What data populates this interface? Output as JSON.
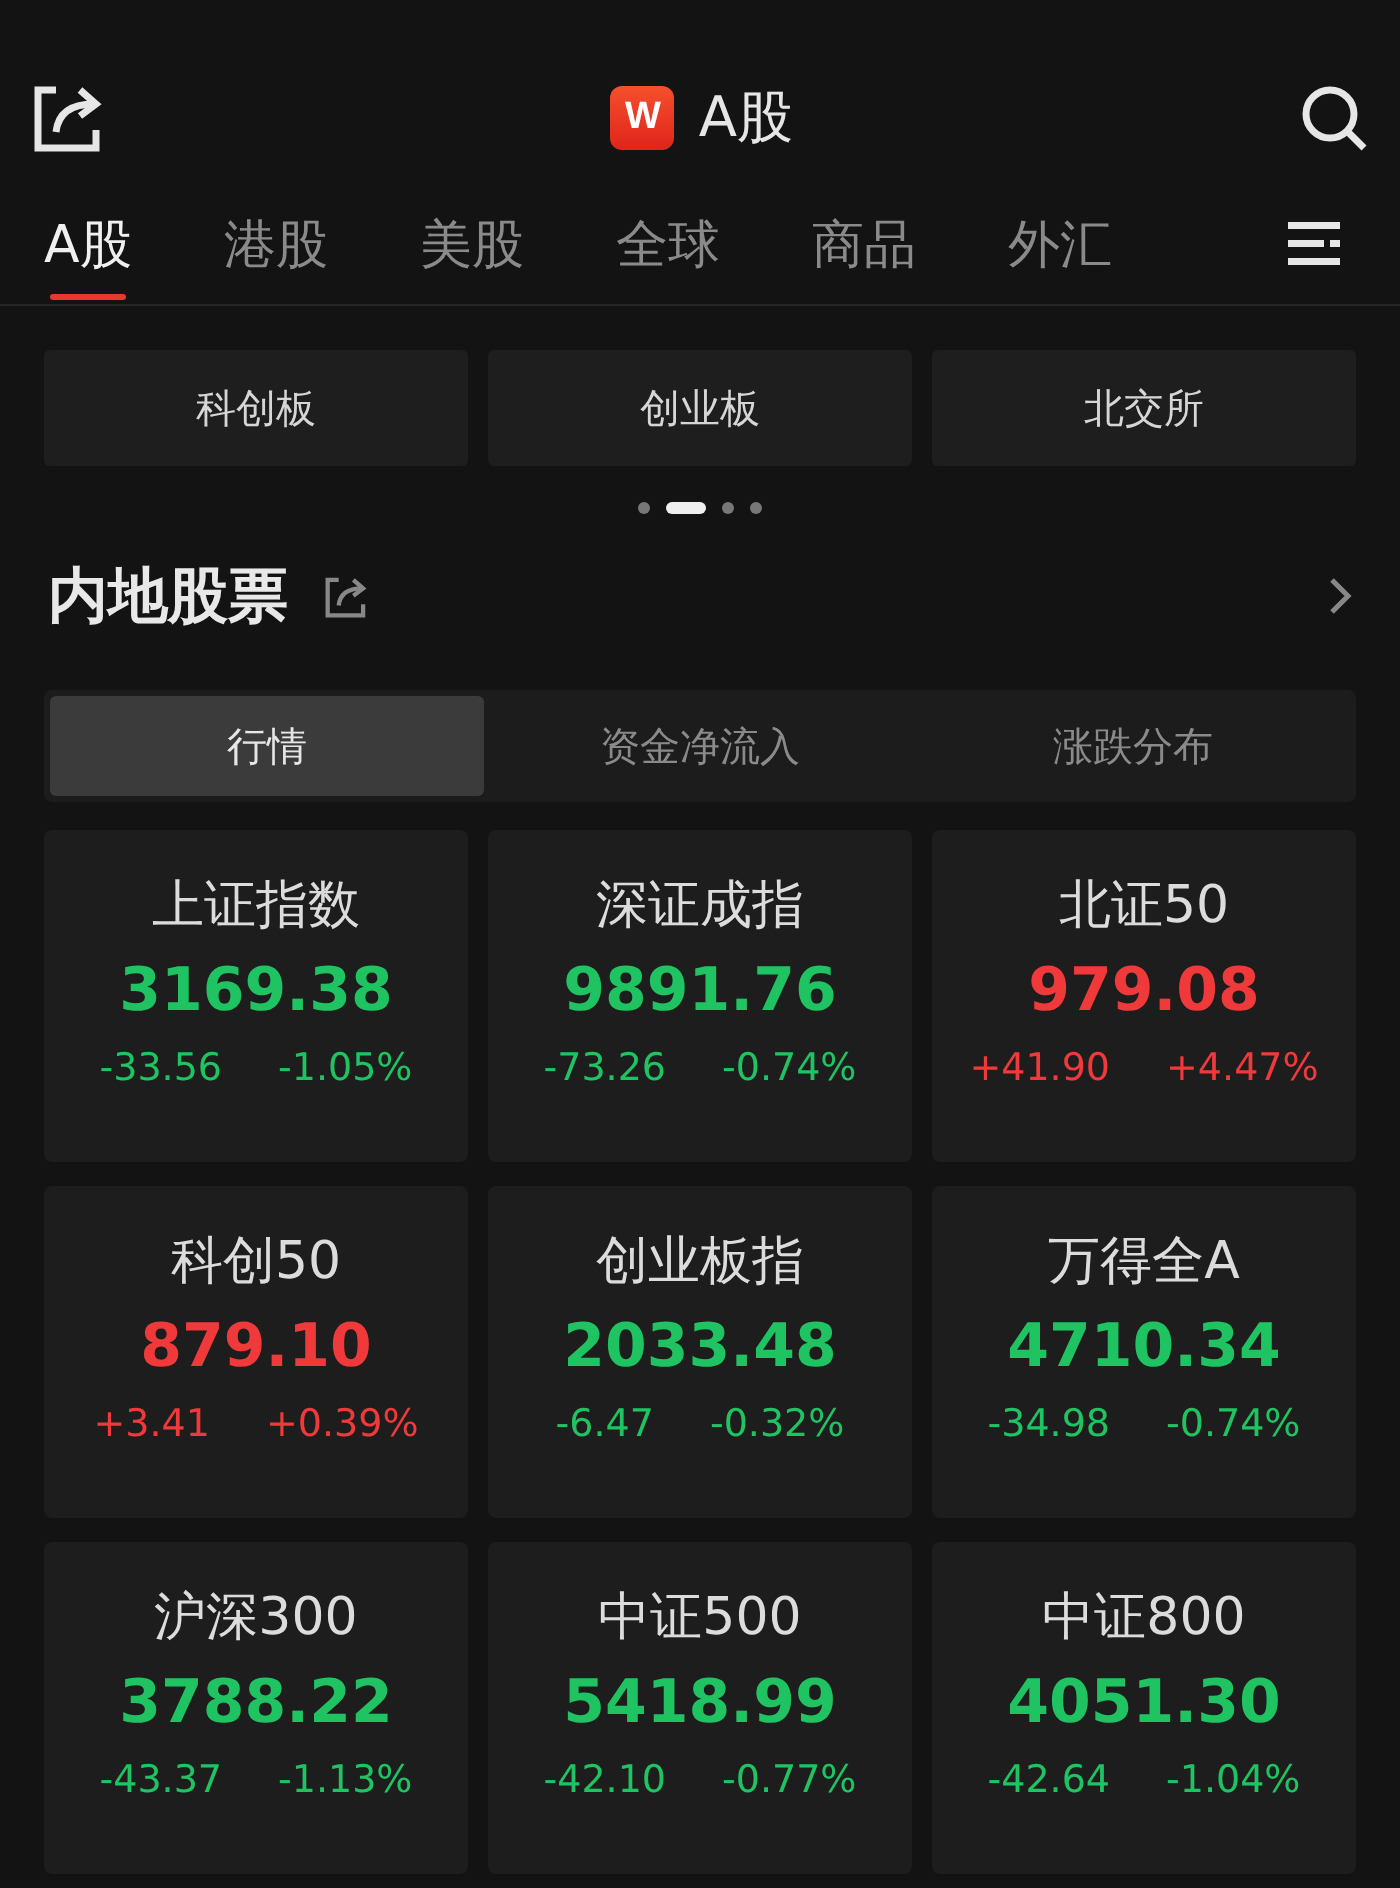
{
  "header": {
    "logo": "W",
    "title": "A股"
  },
  "tabs": [
    {
      "label": "A股",
      "selected": true
    },
    {
      "label": "港股",
      "selected": false
    },
    {
      "label": "美股",
      "selected": false
    },
    {
      "label": "全球",
      "selected": false
    },
    {
      "label": "商品",
      "selected": false
    },
    {
      "label": "外汇",
      "selected": false
    }
  ],
  "boards": [
    "科创板",
    "创业板",
    "北交所"
  ],
  "pager": [
    {
      "selected": false
    },
    {
      "selected": true
    },
    {
      "selected": false
    },
    {
      "selected": false
    }
  ],
  "section": {
    "title": "内地股票"
  },
  "segments": [
    {
      "label": "行情",
      "selected": true
    },
    {
      "label": "资金净流入",
      "selected": false
    },
    {
      "label": "涨跌分布",
      "selected": false
    }
  ],
  "indices": [
    {
      "name": "上证指数",
      "value": "3169.38",
      "change": "-33.56",
      "percent": "-1.05%",
      "color": "#1fc362"
    },
    {
      "name": "深证成指",
      "value": "9891.76",
      "change": "-73.26",
      "percent": "-0.74%",
      "color": "#1fc362"
    },
    {
      "name": "北证50",
      "value": "979.08",
      "change": "+41.90",
      "percent": "+4.47%",
      "color": "#f0393a"
    },
    {
      "name": "科创50",
      "value": "879.10",
      "change": "+3.41",
      "percent": "+0.39%",
      "color": "#f0393a"
    },
    {
      "name": "创业板指",
      "value": "2033.48",
      "change": "-6.47",
      "percent": "-0.32%",
      "color": "#1fc362"
    },
    {
      "name": "万得全A",
      "value": "4710.34",
      "change": "-34.98",
      "percent": "-0.74%",
      "color": "#1fc362"
    },
    {
      "name": "沪深300",
      "value": "3788.22",
      "change": "-43.37",
      "percent": "-1.13%",
      "color": "#1fc362"
    },
    {
      "name": "中证500",
      "value": "5418.99",
      "change": "-42.10",
      "percent": "-0.77%",
      "color": "#1fc362"
    },
    {
      "name": "中证800",
      "value": "4051.30",
      "change": "-42.64",
      "percent": "-1.04%",
      "color": "#1fc362"
    }
  ]
}
